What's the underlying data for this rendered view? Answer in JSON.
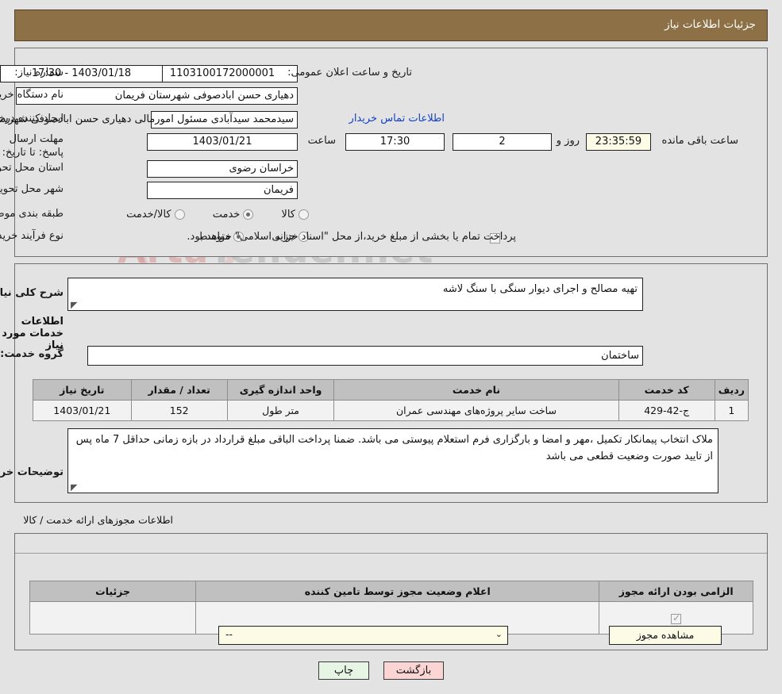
{
  "header": {
    "title": "جزئیات اطلاعات نیاز"
  },
  "watermark": {
    "text_left": "Arta",
    "text_right": "Tender.net"
  },
  "form": {
    "need_number_label": "شماره نیاز:",
    "need_number_value": "1103100172000001",
    "announce_label": "تاریخ و ساعت اعلان عمومی:",
    "announce_value": "17:30 - 1403/01/18",
    "buyer_org_label": "نام دستگاه خریدار:",
    "buyer_org_value": "دهیاری حسن ابادصوفی شهرستان فریمان",
    "requester_label": "ایجاد کننده درخواست:",
    "requester_value": "سیدمحمد سیدآبادی مسئول امورمالی دهیاری حسن ابادصوفی شهرستان فریم",
    "contact_link": "اطلاعات تماس خریدار",
    "deadline_label": "مهلت ارسال پاسخ: تا تاریخ:",
    "deadline_date": "1403/01/21",
    "time_label": "ساعت",
    "deadline_time": "17:30",
    "days_value": "2",
    "days_label": "روز و",
    "countdown_value": "23:35:59",
    "countdown_label": "ساعت باقی مانده",
    "province_label": "استان محل تحویل:",
    "province_value": "خراسان رضوی",
    "city_label": "شهر محل تحویل:",
    "city_value": "فریمان",
    "category_label": "طبقه بندی موضوعی:",
    "category_options": [
      "کالا",
      "خدمت",
      "کالا/خدمت"
    ],
    "category_selected": "خدمت",
    "process_label": "نوع فرآیند خرید :",
    "process_options": [
      "جزیی",
      "متوسط"
    ],
    "process_selected": "متوسط",
    "treasury_checkbox_checked": false,
    "treasury_note": "پرداخت تمام یا بخشی از مبلغ خرید،از محل \"اسناد خزانه اسلامی\" خواهد بود."
  },
  "description": {
    "label": "شرح کلی نیاز:",
    "value": "تهیه مصالح و اجرای دیوار سنگی با سنگ لاشه"
  },
  "services_section": {
    "title": "اطلاعات خدمات مورد نیاز",
    "group_label": "گروه خدمت:",
    "group_value": "ساختمان"
  },
  "services_table": {
    "columns": [
      "ردیف",
      "کد خدمت",
      "نام خدمت",
      "واحد اندازه گیری",
      "تعداد / مقدار",
      "تاریخ نیاز"
    ],
    "rows": [
      {
        "row_no": "1",
        "service_code": "ج-42-429",
        "service_name": "ساخت سایر پروژه‌های مهندسی عمران",
        "unit": "متر طول",
        "quantity": "152",
        "need_date": "1403/01/21"
      }
    ]
  },
  "buyer_notes": {
    "label": "توضیحات خریدار:",
    "value": "ملاک انتخاب پیمانکار تکمیل ،مهر و امضا و بارگزاری فرم استعلام  پیوستی می باشد. ضمنا پرداخت الباقی مبلغ قرارداد در بازه زمانی حداقل 7 ماه پس از تایید صورت وضعیت قطعی می باشد"
  },
  "permits_section": {
    "title": "اطلاعات مجوزهای ارائه خدمت / کالا",
    "columns": [
      "الزامی بودن ارائه مجوز",
      "اعلام وضعیت مجوز توسط تامین کننده",
      "جزئیات"
    ],
    "rows": [
      {
        "required_checked": true,
        "status_value": "--",
        "details_button": "مشاهده مجوز"
      }
    ]
  },
  "footer": {
    "print_label": "چاپ",
    "back_label": "بازگشت"
  }
}
